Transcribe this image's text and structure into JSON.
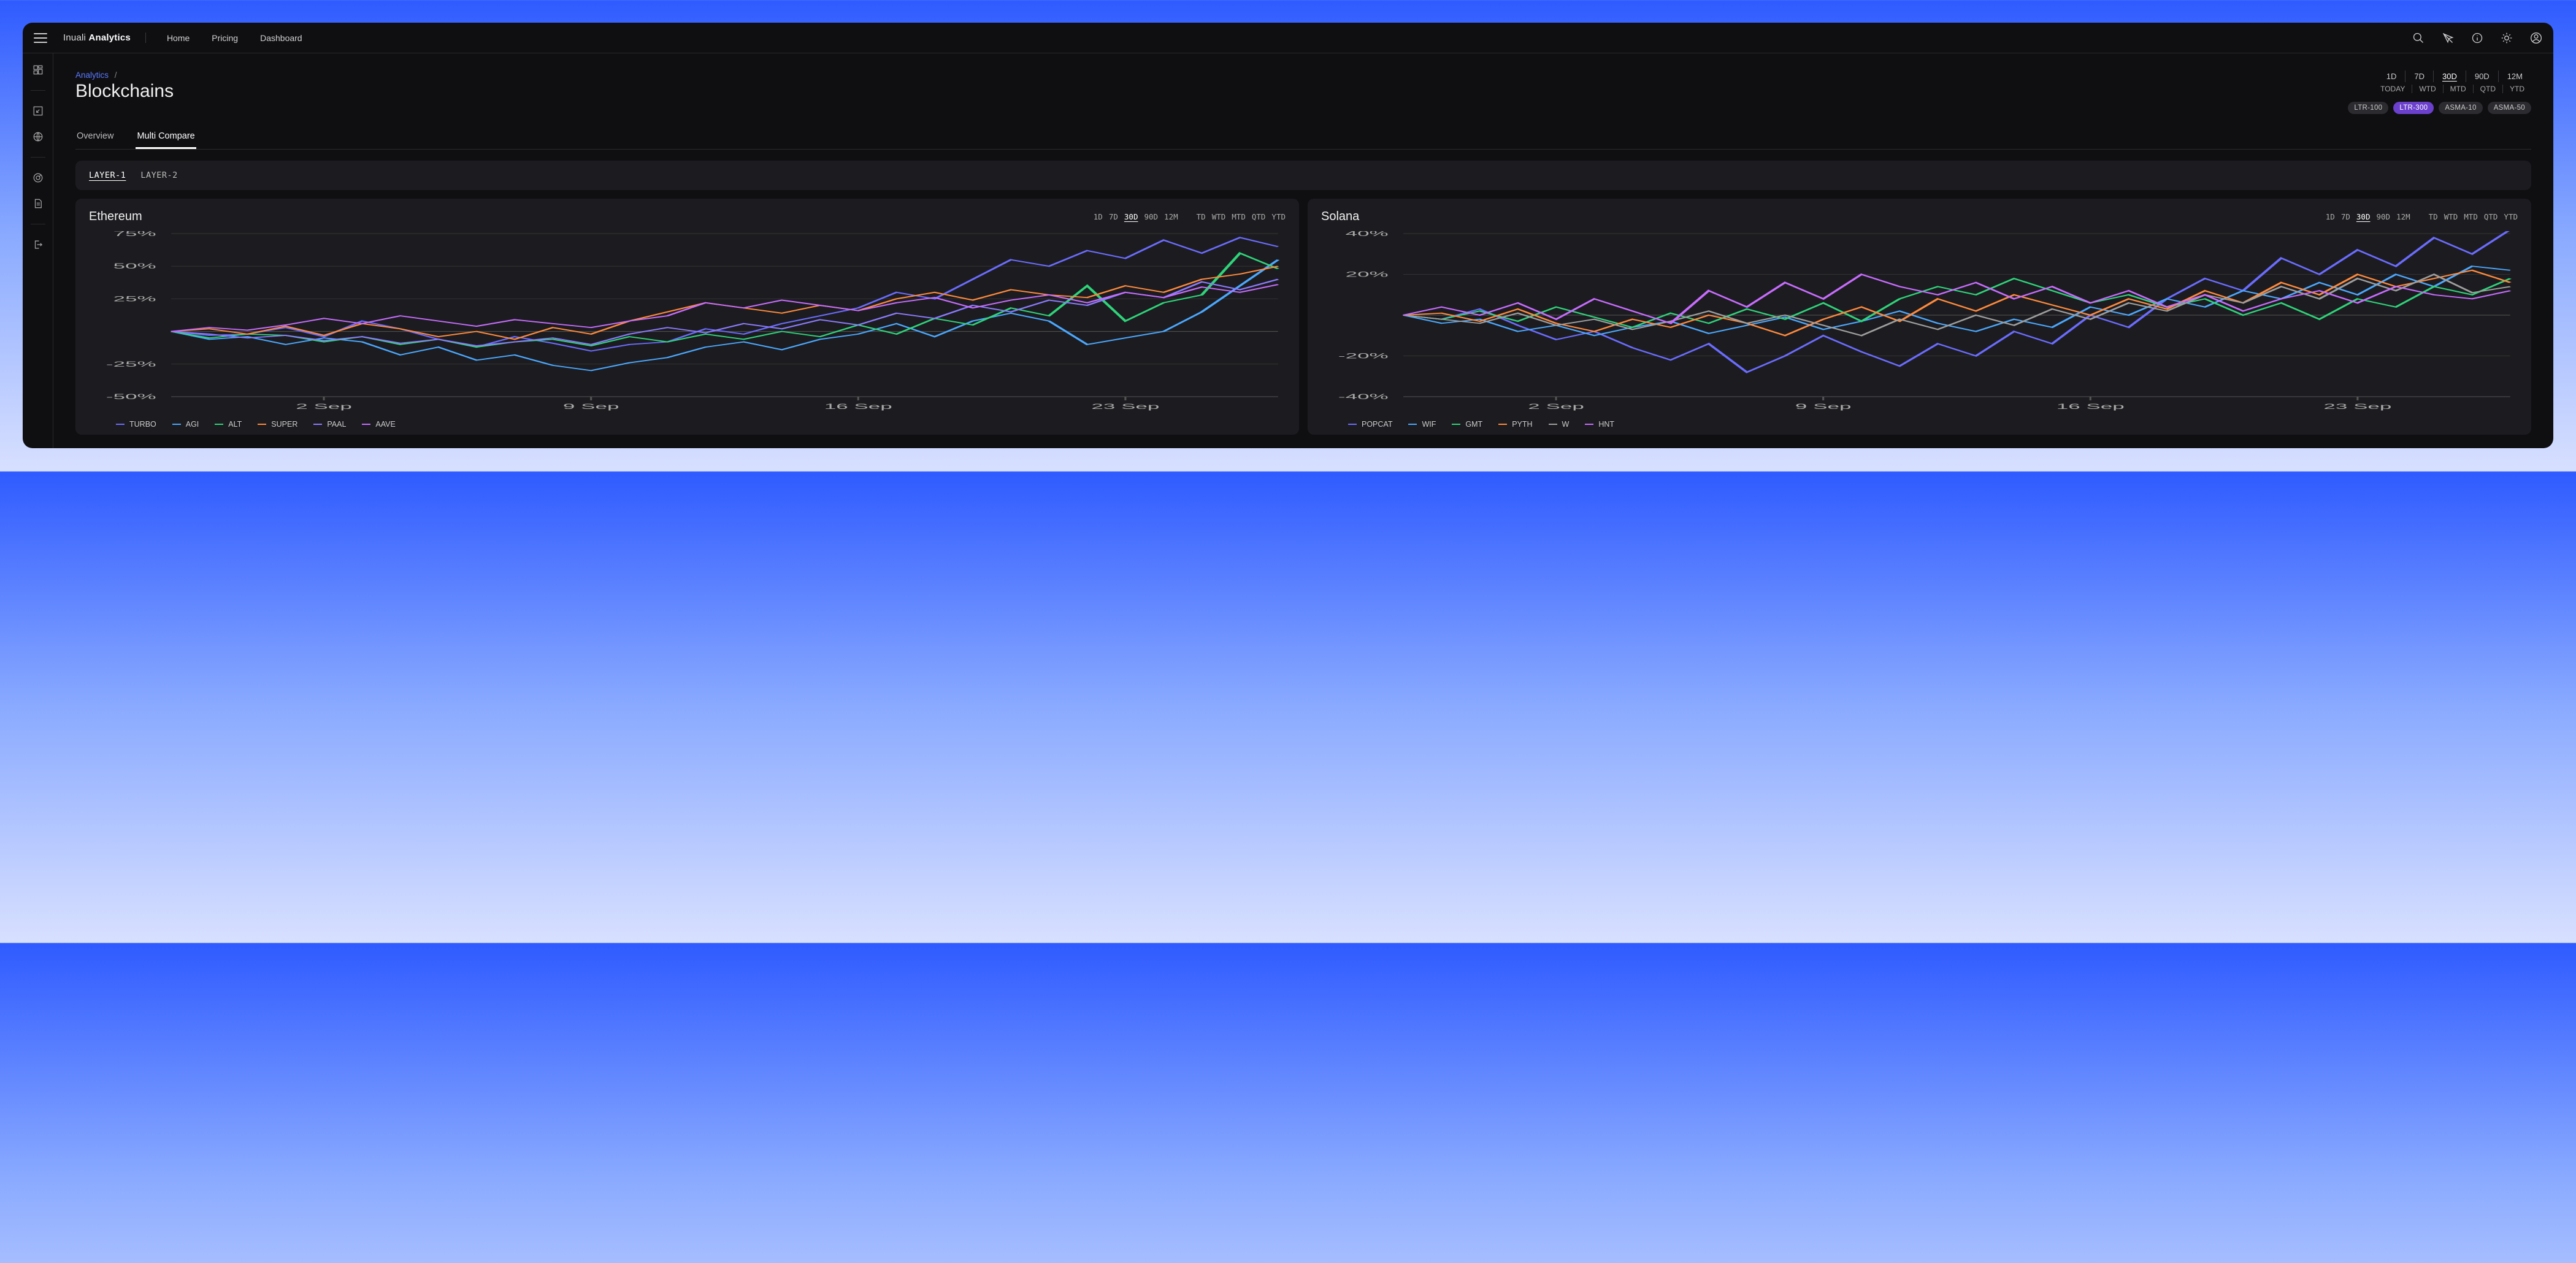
{
  "brand": {
    "light": "Inuali ",
    "bold": "Analytics"
  },
  "nav": {
    "home": "Home",
    "pricing": "Pricing",
    "dashboard": "Dashboard"
  },
  "breadcrumb": {
    "root": "Analytics",
    "sep": "/"
  },
  "page_title": "Blockchains",
  "tabs": {
    "overview": "Overview",
    "multi": "Multi Compare"
  },
  "range_top": [
    "1D",
    "7D",
    "30D",
    "90D",
    "12M"
  ],
  "range_top_active": 2,
  "range_bottom": [
    "TODAY",
    "WTD",
    "MTD",
    "QTD",
    "YTD"
  ],
  "pills": [
    "LTR-100",
    "LTR-300",
    "ASMA-10",
    "ASMA-50"
  ],
  "pills_active": 1,
  "filter_tabs": [
    "LAYER-1",
    "LAYER-2"
  ],
  "filter_active": 0,
  "mini_ranges_a": [
    "1D",
    "7D",
    "30D",
    "90D",
    "12M"
  ],
  "mini_ranges_b": [
    "TD",
    "WTD",
    "MTD",
    "QTD",
    "YTD"
  ],
  "mini_active": 2,
  "cards": {
    "eth": {
      "title": "Ethereum",
      "legend": [
        "TURBO",
        "AGI",
        "ALT",
        "SUPER",
        "PAAL",
        "AAVE"
      ],
      "colors": [
        "#6b6cff",
        "#4ba8ff",
        "#2fd47a",
        "#ff8a3d",
        "#8c7bff",
        "#c86cff"
      ]
    },
    "sol": {
      "title": "Solana",
      "legend": [
        "POPCAT",
        "WIF",
        "GMT",
        "PYTH",
        "W",
        "HNT"
      ],
      "colors": [
        "#6b6cff",
        "#4ba8ff",
        "#2fd47a",
        "#ff8a3d",
        "#9e9e9e",
        "#c86cff"
      ]
    }
  },
  "chart_data": [
    {
      "card": "eth",
      "type": "line",
      "title": "Ethereum",
      "xlabel": "",
      "ylabel": "",
      "ylim": [
        -50,
        75
      ],
      "y_ticks": [
        -50,
        -25,
        0,
        25,
        50,
        75
      ],
      "y_tick_labels": [
        "-50%",
        "-25%",
        "",
        "25%",
        "50%",
        "75%"
      ],
      "x_ticks": [
        4,
        11,
        18,
        25
      ],
      "x_tick_labels": [
        "2 Sep",
        "9 Sep",
        "16 Sep",
        "23 Sep"
      ],
      "x_range": [
        0,
        29
      ],
      "series": [
        {
          "name": "TURBO",
          "color": "#6b6cff",
          "values": [
            0,
            -3,
            -2,
            3,
            -4,
            8,
            2,
            -6,
            -12,
            -4,
            -9,
            -15,
            -10,
            -8,
            2,
            -2,
            6,
            12,
            18,
            30,
            25,
            40,
            55,
            50,
            62,
            56,
            70,
            60,
            72,
            65
          ]
        },
        {
          "name": "AGI",
          "color": "#4ba8ff",
          "values": [
            0,
            -6,
            -4,
            -10,
            -5,
            -8,
            -18,
            -12,
            -22,
            -18,
            -26,
            -30,
            -24,
            -20,
            -12,
            -8,
            -14,
            -6,
            -2,
            6,
            -4,
            8,
            14,
            8,
            -10,
            -5,
            0,
            15,
            35,
            55
          ]
        },
        {
          "name": "ALT",
          "color": "#2fd47a",
          "values": [
            0,
            -5,
            -2,
            -3,
            -8,
            -4,
            -10,
            -6,
            -12,
            -8,
            -6,
            -11,
            -4,
            -8,
            -2,
            -6,
            0,
            -4,
            5,
            -2,
            10,
            5,
            18,
            12,
            35,
            8,
            22,
            28,
            60,
            48
          ]
        },
        {
          "name": "SUPER",
          "color": "#ff8a3d",
          "values": [
            0,
            2,
            -2,
            4,
            -3,
            6,
            2,
            -4,
            0,
            -6,
            3,
            -2,
            8,
            15,
            22,
            18,
            14,
            20,
            16,
            25,
            30,
            24,
            32,
            28,
            26,
            35,
            30,
            40,
            44,
            50
          ]
        },
        {
          "name": "PAAL",
          "color": "#8c7bff",
          "values": [
            0,
            -2,
            -5,
            -3,
            -7,
            -4,
            -9,
            -6,
            -11,
            -8,
            -5,
            -10,
            -2,
            3,
            -1,
            6,
            2,
            9,
            5,
            14,
            10,
            20,
            15,
            24,
            20,
            30,
            26,
            38,
            32,
            40
          ]
        },
        {
          "name": "AAVE",
          "color": "#c86cff",
          "values": [
            0,
            3,
            1,
            5,
            10,
            6,
            12,
            8,
            4,
            9,
            6,
            3,
            8,
            12,
            22,
            18,
            24,
            20,
            16,
            22,
            26,
            18,
            24,
            28,
            22,
            30,
            26,
            34,
            30,
            36
          ]
        }
      ]
    },
    {
      "card": "sol",
      "type": "line",
      "title": "Solana",
      "xlabel": "",
      "ylabel": "",
      "ylim": [
        -40,
        40
      ],
      "y_ticks": [
        -40,
        -20,
        0,
        20,
        40
      ],
      "y_tick_labels": [
        "-40%",
        "-20%",
        "",
        "20%",
        "40%"
      ],
      "x_ticks": [
        4,
        11,
        18,
        25
      ],
      "x_tick_labels": [
        "2 Sep",
        "9 Sep",
        "16 Sep",
        "23 Sep"
      ],
      "x_range": [
        0,
        29
      ],
      "series": [
        {
          "name": "POPCAT",
          "color": "#6b6cff",
          "values": [
            0,
            -2,
            3,
            -5,
            -12,
            -8,
            -16,
            -22,
            -14,
            -28,
            -20,
            -10,
            -18,
            -25,
            -14,
            -20,
            -8,
            -14,
            0,
            -6,
            8,
            18,
            12,
            28,
            20,
            32,
            24,
            38,
            30,
            42
          ]
        },
        {
          "name": "WIF",
          "color": "#4ba8ff",
          "values": [
            0,
            -4,
            -2,
            -8,
            -5,
            -10,
            -6,
            -3,
            -9,
            -5,
            -1,
            -7,
            -3,
            2,
            -4,
            -8,
            -2,
            -6,
            4,
            0,
            8,
            4,
            12,
            8,
            16,
            10,
            20,
            14,
            24,
            22
          ]
        },
        {
          "name": "GMT",
          "color": "#2fd47a",
          "values": [
            0,
            -2,
            2,
            -3,
            4,
            -1,
            -6,
            1,
            -4,
            3,
            -2,
            6,
            -3,
            8,
            14,
            10,
            18,
            12,
            6,
            10,
            4,
            8,
            0,
            6,
            -2,
            8,
            4,
            14,
            10,
            18
          ]
        },
        {
          "name": "PYTH",
          "color": "#ff8a3d",
          "values": [
            0,
            1,
            -3,
            3,
            -4,
            -8,
            -2,
            -6,
            0,
            -4,
            -10,
            -2,
            4,
            -3,
            8,
            2,
            10,
            5,
            0,
            8,
            3,
            12,
            6,
            16,
            10,
            20,
            14,
            18,
            22,
            16
          ]
        },
        {
          "name": "W",
          "color": "#9e9e9e",
          "values": [
            0,
            -2,
            -4,
            1,
            -5,
            -2,
            -7,
            -3,
            2,
            -4,
            0,
            -5,
            -10,
            -2,
            -7,
            0,
            -5,
            3,
            -2,
            6,
            2,
            10,
            6,
            14,
            8,
            18,
            12,
            20,
            11,
            14
          ]
        },
        {
          "name": "HNT",
          "color": "#c86cff",
          "values": [
            0,
            4,
            0,
            6,
            -2,
            8,
            2,
            -4,
            12,
            4,
            16,
            8,
            20,
            14,
            10,
            16,
            8,
            14,
            6,
            12,
            4,
            10,
            2,
            8,
            12,
            6,
            14,
            10,
            8,
            12
          ]
        }
      ]
    }
  ]
}
